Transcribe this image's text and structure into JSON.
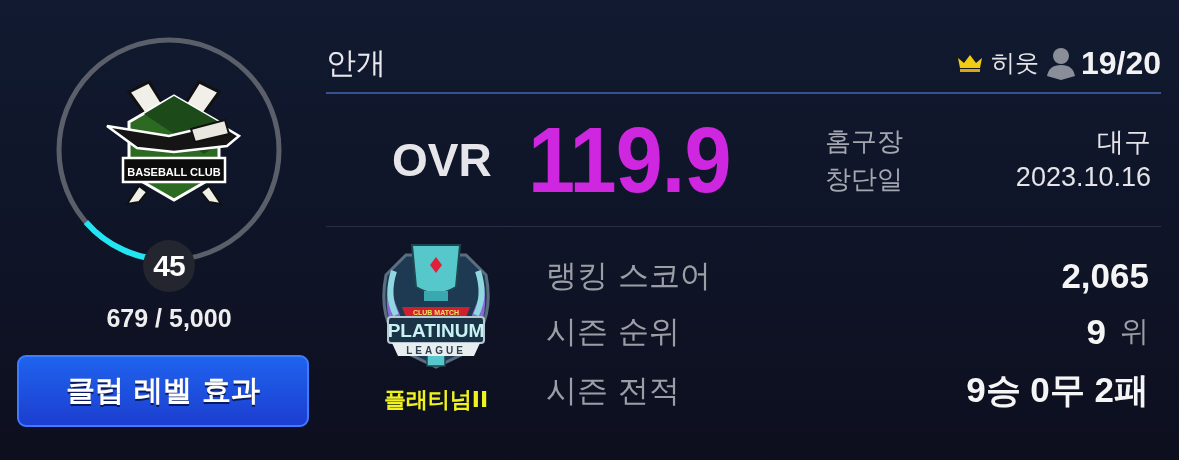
{
  "club": {
    "emblem": {
      "label": "BASEBALL CLUB"
    },
    "level": "45",
    "exp": "679 / 5,000",
    "exp_progress": {
      "level": 0.136
    },
    "button": "클럽 레벨 효과"
  },
  "header": {
    "name": "안개",
    "role": "히웃",
    "members": "19/20"
  },
  "ovr": {
    "label": "OVR",
    "value": "119.9"
  },
  "info": [
    {
      "label": "홈구장",
      "value": "대구"
    },
    {
      "label": "창단일",
      "value": "2023.10.16"
    }
  ],
  "league": {
    "emblem": {
      "ribbon": "CLUB MATCH",
      "title": "PLATINUM",
      "subtitle": "LEAGUE"
    },
    "name": "플래티넘II"
  },
  "stats": [
    {
      "label": "랭킹 스코어",
      "value": "2,065"
    },
    {
      "label": "시즌 순위",
      "value": "9",
      "unit": "위"
    },
    {
      "label": "시즌 전적",
      "value": "9승 0무 2패"
    }
  ]
}
